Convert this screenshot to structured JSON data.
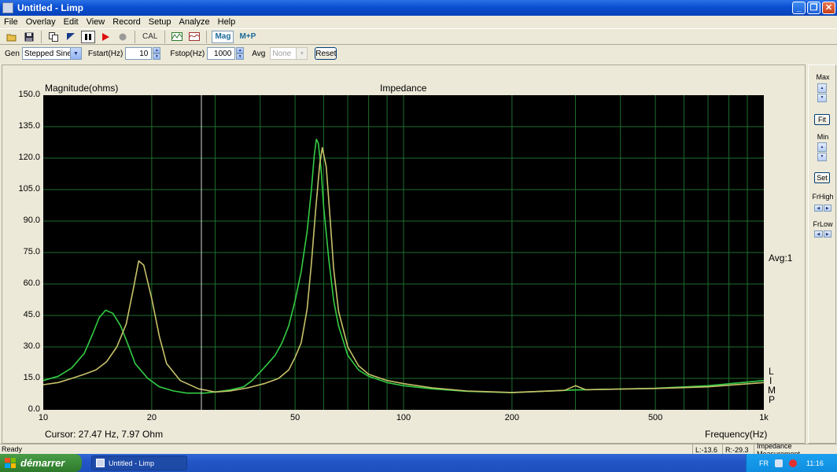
{
  "window": {
    "title": "Untitled - Limp"
  },
  "menu": [
    "File",
    "Overlay",
    "Edit",
    "View",
    "Record",
    "Setup",
    "Analyze",
    "Help"
  ],
  "toolbar": {
    "cal_label": "CAL",
    "mag_label": "Mag",
    "magphase_label": "M+P"
  },
  "controls": {
    "gen_label": "Gen",
    "gen_value": "Stepped Sine",
    "fstart_label": "Fstart(Hz)",
    "fstart_value": "10",
    "fstop_label": "Fstop(Hz)",
    "fstop_value": "1000",
    "avg_label": "Avg",
    "avg_value": "None",
    "reset_label": "Reset"
  },
  "plot": {
    "cursor_readout": "Cursor: 27.47 Hz, 7.97 Ohm",
    "avg_text": "Avg:1",
    "watermark": [
      "L",
      "I",
      "M",
      "P"
    ]
  },
  "right_panel": {
    "max_label": "Max",
    "fit_label": "Fit",
    "min_label": "Min",
    "set_label": "Set",
    "frhigh_label": "FrHigh",
    "frlow_label": "FrLow"
  },
  "status": {
    "ready": "Ready",
    "left": "L:-13.6",
    "right": "R:-29.3",
    "mode": "Impedance Measurement"
  },
  "taskbar": {
    "start_label": "démarrer",
    "task_item": "Untitled - Limp",
    "lang": "FR",
    "time": "11:16"
  },
  "colors": {
    "plot_bg": "#000000",
    "grid": "#1e6e2e",
    "series_green": "#33cc44",
    "series_yellow": "#c8c26a",
    "cursor": "#d8d8d8"
  },
  "chart_data": {
    "type": "line",
    "title": "Impedance",
    "xlabel": "Frequency(Hz)",
    "ylabel": "Magnitude(ohms)",
    "xscale": "log",
    "xlim": [
      10,
      1000
    ],
    "ylim": [
      0,
      150
    ],
    "xticks": [
      10,
      20,
      50,
      100,
      200,
      500,
      1000
    ],
    "xtick_labels": [
      "10",
      "20",
      "50",
      "100",
      "200",
      "500",
      "1k"
    ],
    "yticks": [
      0,
      15,
      30,
      45,
      60,
      75,
      90,
      105,
      120,
      135,
      150
    ],
    "ytick_labels": [
      "0.0",
      "15.0",
      "30.0",
      "45.0",
      "60.0",
      "75.0",
      "90.0",
      "105.0",
      "120.0",
      "135.0",
      "150.0"
    ],
    "grid": true,
    "cursor_x": 27.47,
    "series": [
      {
        "color": "#33cc44",
        "points": [
          [
            10,
            14
          ],
          [
            11,
            16
          ],
          [
            12,
            20
          ],
          [
            13,
            27
          ],
          [
            13.7,
            36
          ],
          [
            14.3,
            44
          ],
          [
            14.9,
            47.5
          ],
          [
            15.6,
            46
          ],
          [
            16.4,
            40
          ],
          [
            17.2,
            31
          ],
          [
            18,
            22
          ],
          [
            19.5,
            15
          ],
          [
            21,
            11
          ],
          [
            23,
            9
          ],
          [
            25,
            8
          ],
          [
            28,
            8
          ],
          [
            30,
            8.5
          ],
          [
            33,
            9.5
          ],
          [
            36,
            11
          ],
          [
            38,
            14
          ],
          [
            40,
            18
          ],
          [
            42,
            22
          ],
          [
            44,
            26
          ],
          [
            46,
            32
          ],
          [
            48,
            40
          ],
          [
            50,
            52
          ],
          [
            52,
            66
          ],
          [
            54,
            85
          ],
          [
            55.5,
            105
          ],
          [
            56.5,
            121
          ],
          [
            57.3,
            129
          ],
          [
            58,
            127
          ],
          [
            59,
            115
          ],
          [
            60,
            97
          ],
          [
            62,
            72
          ],
          [
            64,
            52
          ],
          [
            66,
            40
          ],
          [
            70,
            26
          ],
          [
            75,
            19
          ],
          [
            80,
            16
          ],
          [
            90,
            13
          ],
          [
            100,
            11.5
          ],
          [
            120,
            10
          ],
          [
            150,
            8.8
          ],
          [
            200,
            8.2
          ],
          [
            300,
            9.5
          ],
          [
            500,
            10.3
          ],
          [
            700,
            11.5
          ],
          [
            1000,
            14
          ]
        ]
      },
      {
        "color": "#c8c26a",
        "points": [
          [
            10,
            12
          ],
          [
            11,
            13
          ],
          [
            12,
            15
          ],
          [
            13,
            17
          ],
          [
            14,
            19
          ],
          [
            15,
            23
          ],
          [
            16,
            30
          ],
          [
            17,
            41
          ],
          [
            17.8,
            58
          ],
          [
            18.4,
            71
          ],
          [
            19,
            69
          ],
          [
            20,
            53
          ],
          [
            21,
            35
          ],
          [
            22,
            22
          ],
          [
            24,
            14
          ],
          [
            27,
            10
          ],
          [
            30,
            8.5
          ],
          [
            33,
            9
          ],
          [
            37,
            10.5
          ],
          [
            41,
            12.5
          ],
          [
            45,
            15
          ],
          [
            48,
            19
          ],
          [
            50,
            25
          ],
          [
            52,
            32
          ],
          [
            54,
            48
          ],
          [
            55.5,
            70
          ],
          [
            57,
            95
          ],
          [
            58.5,
            117
          ],
          [
            59.5,
            125
          ],
          [
            61,
            116
          ],
          [
            62.5,
            92
          ],
          [
            64,
            67
          ],
          [
            66,
            47
          ],
          [
            70,
            30
          ],
          [
            75,
            21
          ],
          [
            80,
            17
          ],
          [
            90,
            14
          ],
          [
            100,
            12.5
          ],
          [
            120,
            10.5
          ],
          [
            150,
            9
          ],
          [
            200,
            8.3
          ],
          [
            280,
            9.3
          ],
          [
            300,
            11.5
          ],
          [
            320,
            9.6
          ],
          [
            500,
            10.2
          ],
          [
            700,
            11
          ],
          [
            1000,
            13
          ]
        ]
      }
    ]
  }
}
